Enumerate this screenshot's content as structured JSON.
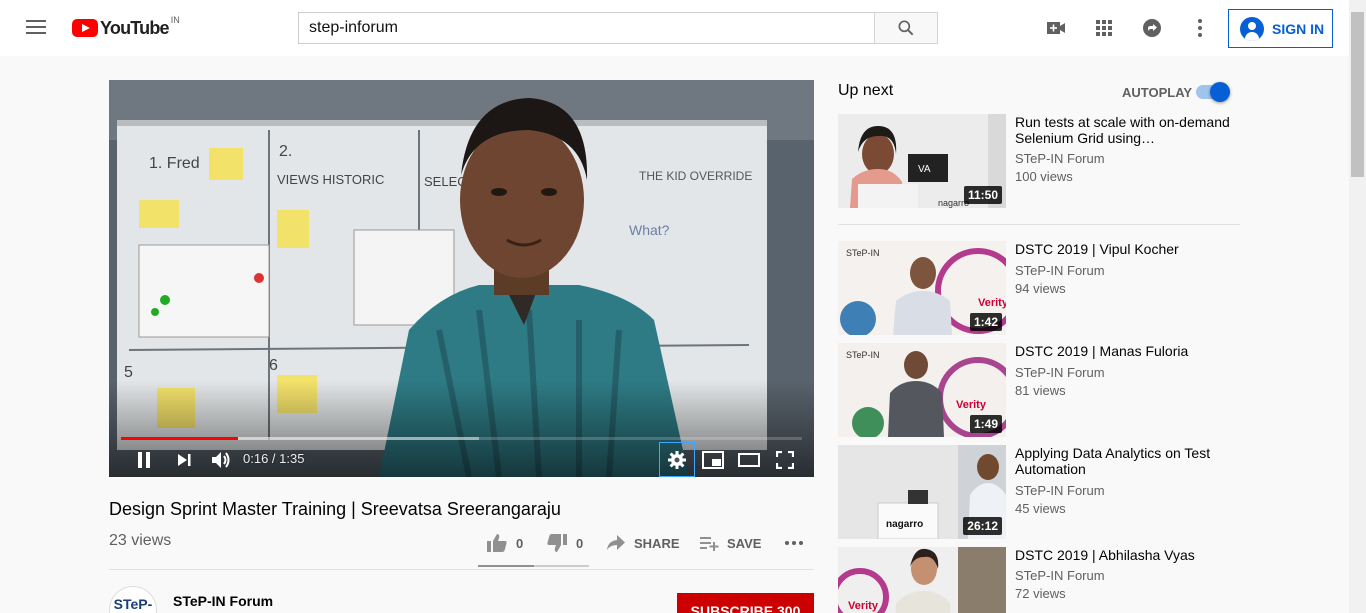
{
  "header": {
    "logo_text": "YouTube",
    "country": "IN",
    "search_value": "step-inforum",
    "search_placeholder": "Search",
    "sign_in_label": "SIGN IN"
  },
  "player": {
    "time_current": "0:16",
    "time_separator": " / ",
    "time_total": "1:35",
    "played_fraction": 0.172,
    "buffered_fraction": 0.525
  },
  "video": {
    "title": "Design Sprint Master Training | Sreevatsa Sreerangaraju",
    "views": "23 views",
    "likes": "0",
    "dislikes": "0",
    "share_label": "SHARE",
    "save_label": "SAVE",
    "channel_name": "STeP-IN Forum",
    "channel_avatar_text": "STeP-IN",
    "subscribe_label": "SUBSCRIBE",
    "subscriber_count": "300"
  },
  "sidebar": {
    "up_next_label": "Up next",
    "autoplay_label": "AUTOPLAY",
    "autoplay_on": true,
    "items": [
      {
        "title": "Run tests at scale with on-demand Selenium Grid using…",
        "channel": "STeP-IN Forum",
        "views": "100 views",
        "duration": "11:50"
      },
      {
        "title": "DSTC 2019 | Vipul Kocher",
        "channel": "STeP-IN Forum",
        "views": "94 views",
        "duration": "1:42"
      },
      {
        "title": "DSTC 2019 | Manas Fuloria",
        "channel": "STeP-IN Forum",
        "views": "81 views",
        "duration": "1:49"
      },
      {
        "title": "Applying Data Analytics on Test Automation",
        "channel": "STeP-IN Forum",
        "views": "45 views",
        "duration": "26:12"
      },
      {
        "title": "DSTC 2019 | Abhilasha Vyas",
        "channel": "STeP-IN Forum",
        "views": "72 views",
        "duration": ""
      }
    ]
  },
  "colors": {
    "brand_red": "#ff0000",
    "accent_blue": "#065fd4",
    "subscribe_red": "#cc0000"
  }
}
